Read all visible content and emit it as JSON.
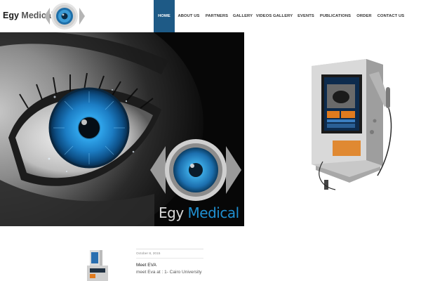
{
  "brand": {
    "name_part1": "Egy",
    "name_part2": " Medical"
  },
  "nav": {
    "items": [
      {
        "label": "HOME",
        "active": true
      },
      {
        "label": "ABOUT US"
      },
      {
        "label": "PARTNERS"
      },
      {
        "label": "GALLERY"
      },
      {
        "label": "VIDEOS GALLERY"
      },
      {
        "label": "EVENTS"
      },
      {
        "label": "PUBLICATIONS"
      },
      {
        "label": "ORDER"
      },
      {
        "label": "CONTACT US"
      }
    ]
  },
  "hero": {
    "brand_part1": "Egy",
    "brand_part2": " Medical"
  },
  "news": {
    "date": "October 8, 2015",
    "title": "Meet EVA",
    "excerpt": "meet Eva at : 1- Cairo University"
  },
  "colors": {
    "nav_active_bg": "#1e5a86",
    "iris_blue": "#1f8fd0"
  },
  "icons": {
    "logo": "eye-logo-icon"
  }
}
